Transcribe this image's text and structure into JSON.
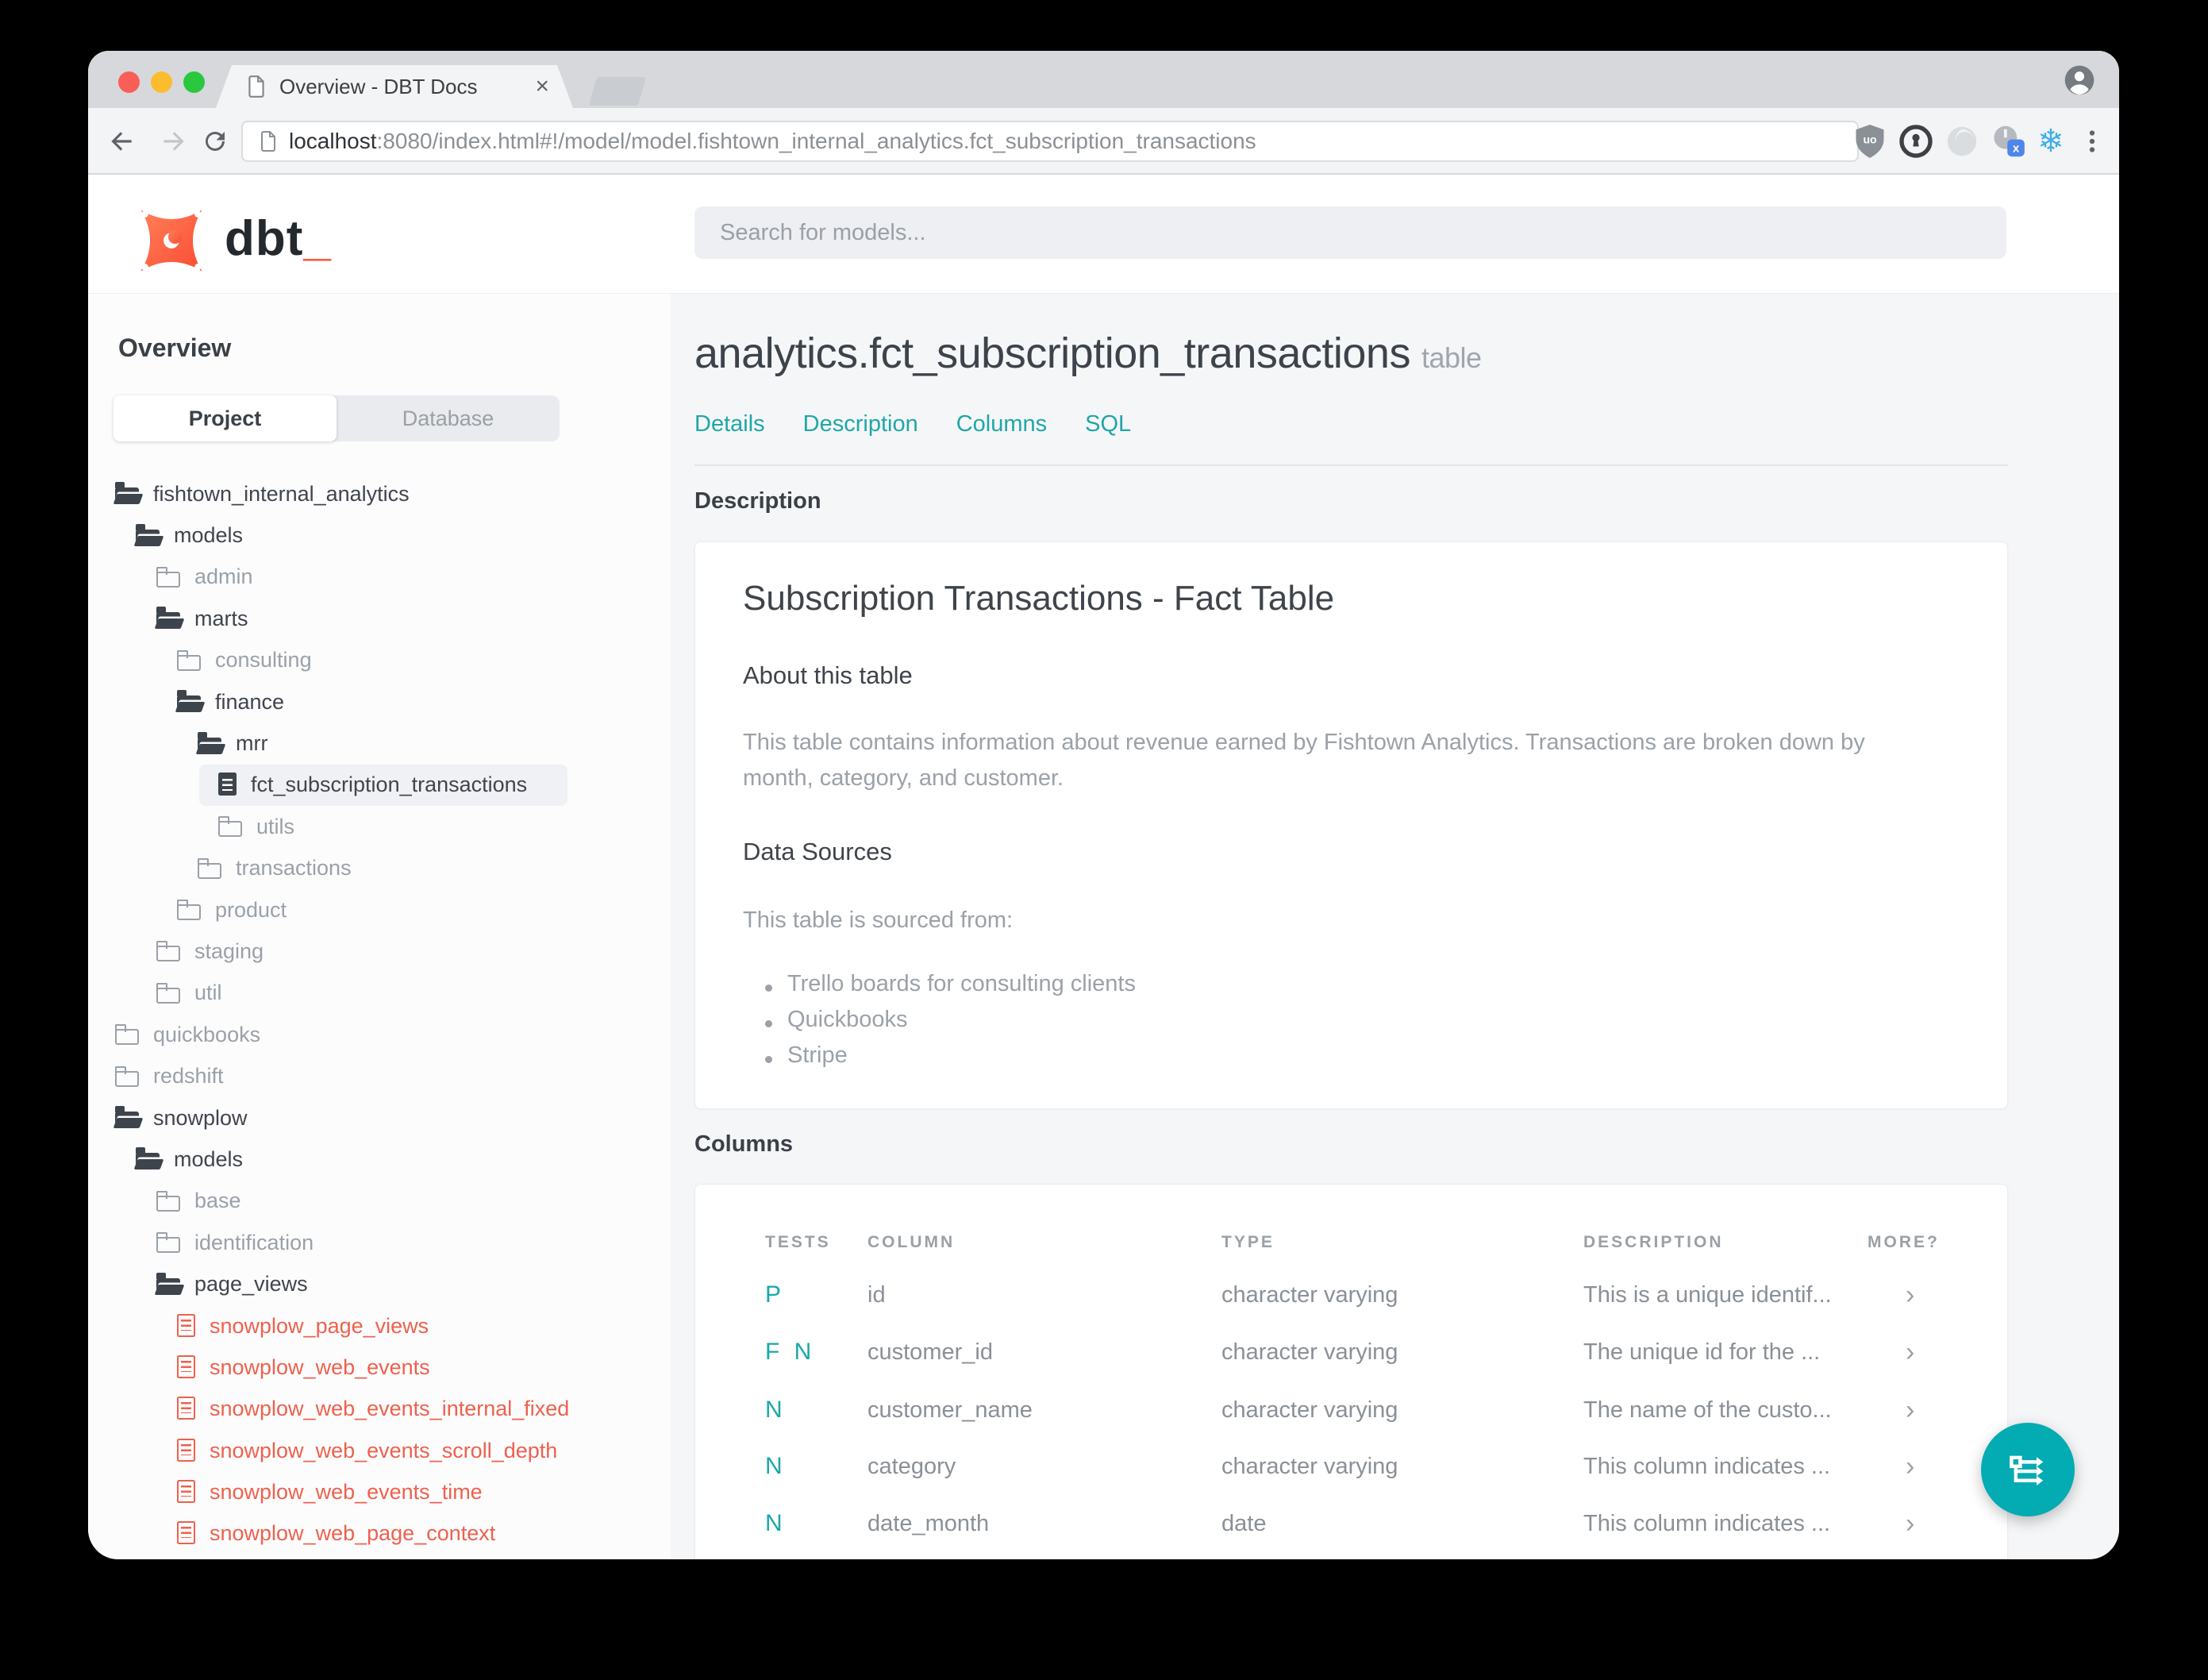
{
  "browser": {
    "tab_title": "Overview - DBT Docs",
    "url": {
      "host": "localhost",
      "path": ":8080/index.html#!/model/model.fishtown_internal_analytics.fct_subscription_transactions"
    },
    "extension_icons": [
      "ublock-origin",
      "onepassword",
      "loop",
      "power-x-badge",
      "snowflake",
      "kebab-menu"
    ],
    "snowflake_glyph": "❄"
  },
  "header": {
    "logo_text": "dbt",
    "logo_underscore": "_",
    "search_placeholder": "Search for models..."
  },
  "sidebar": {
    "overview_label": "Overview",
    "tabs": {
      "project": "Project",
      "database": "Database"
    },
    "tree": [
      {
        "label": "fishtown_internal_analytics"
      },
      {
        "label": "models"
      },
      {
        "label": "admin"
      },
      {
        "label": "marts"
      },
      {
        "label": "consulting"
      },
      {
        "label": "finance"
      },
      {
        "label": "mrr"
      },
      {
        "label": "fct_subscription_transactions"
      },
      {
        "label": "utils"
      },
      {
        "label": "transactions"
      },
      {
        "label": "product"
      },
      {
        "label": "staging"
      },
      {
        "label": "util"
      },
      {
        "label": "quickbooks"
      },
      {
        "label": "redshift"
      },
      {
        "label": "snowplow"
      },
      {
        "label": "models"
      },
      {
        "label": "base"
      },
      {
        "label": "identification"
      },
      {
        "label": "page_views"
      },
      {
        "label": "snowplow_page_views"
      },
      {
        "label": "snowplow_web_events"
      },
      {
        "label": "snowplow_web_events_internal_fixed"
      },
      {
        "label": "snowplow_web_events_scroll_depth"
      },
      {
        "label": "snowplow_web_events_time"
      },
      {
        "label": "snowplow_web_page_context"
      }
    ]
  },
  "main": {
    "title": "analytics.fct_subscription_transactions",
    "title_suffix": "table",
    "nav": [
      "Details",
      "Description",
      "Columns",
      "SQL"
    ],
    "description": {
      "section_heading": "Description",
      "card_title": "Subscription Transactions - Fact Table",
      "about_heading": "About this table",
      "about_text": "This table contains information about revenue earned by Fishtown Analytics. Transactions are broken down by month, category, and customer.",
      "sources_heading": "Data Sources",
      "sources_intro": "This table is sourced from:",
      "sources": [
        "Trello boards for consulting clients",
        "Quickbooks",
        "Stripe"
      ]
    },
    "columns": {
      "section_heading": "Columns",
      "headers": [
        "TESTS",
        "COLUMN",
        "TYPE",
        "DESCRIPTION",
        "MORE?"
      ],
      "rows": [
        {
          "tests": "P",
          "column": "id",
          "type": "character varying",
          "description": "This is a unique identif...",
          "more": "›"
        },
        {
          "tests": "F N",
          "column": "customer_id",
          "type": "character varying",
          "description": "The unique id for the ...",
          "more": "›"
        },
        {
          "tests": "N",
          "column": "customer_name",
          "type": "character varying",
          "description": "The name of the custo...",
          "more": "›"
        },
        {
          "tests": "N",
          "column": "category",
          "type": "character varying",
          "description": "This column indicates ...",
          "more": "›"
        },
        {
          "tests": "N",
          "column": "date_month",
          "type": "date",
          "description": "This column indicates ...",
          "more": "›"
        }
      ]
    }
  },
  "colors": {
    "accent_teal": "#1fa7a7",
    "fab_teal": "#03abb3",
    "file_red": "#ee614d",
    "brand_orange": "#fc4e32",
    "tree_dark": "#3e444c",
    "muted_gray": "#9ba1a8"
  }
}
